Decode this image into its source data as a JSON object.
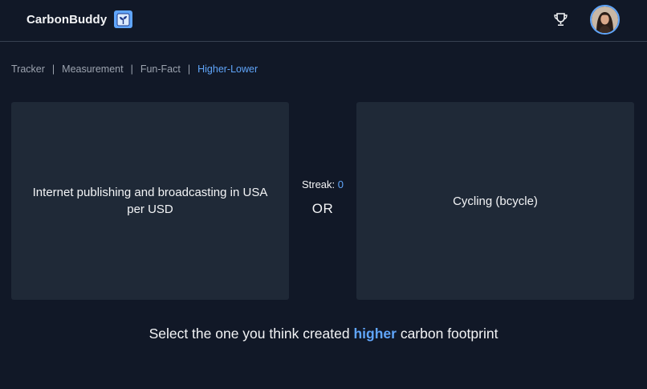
{
  "header": {
    "brand": "CarbonBuddy",
    "logo_icon": "seedling-icon",
    "trophy_icon": "trophy-icon",
    "avatar_icon": "user-avatar"
  },
  "nav": {
    "items": [
      {
        "label": "Tracker",
        "active": false
      },
      {
        "label": "Measurement",
        "active": false
      },
      {
        "label": "Fun-Fact",
        "active": false
      },
      {
        "label": "Higher-Lower",
        "active": true
      }
    ],
    "separator": "|"
  },
  "game": {
    "left_option": "Internet publishing and broadcasting in USA per USD",
    "right_option": "Cycling (bcycle)",
    "streak_label": "Streak:",
    "streak_value": "0",
    "or_label": "OR"
  },
  "prompt": {
    "before": "Select the one you think created",
    "highlight": "higher",
    "after": "carbon footprint"
  },
  "colors": {
    "background": "#111827",
    "card": "#1f2937",
    "accent": "#60a5fa",
    "text": "#f3f4f6",
    "muted": "#9ca3af"
  }
}
